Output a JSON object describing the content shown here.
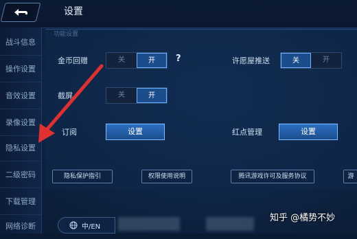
{
  "header": {
    "title": "设置",
    "back_icon": "back-arrow-icon"
  },
  "sidebar": {
    "items": [
      {
        "label": "战斗信息"
      },
      {
        "label": "操作设置"
      },
      {
        "label": "音效设置"
      },
      {
        "label": "录像设置"
      },
      {
        "label": "隐私设置"
      },
      {
        "label": "二级密码"
      },
      {
        "label": "下载管理"
      },
      {
        "label": "网络诊断"
      }
    ]
  },
  "panel": {
    "section_label": "功能设置",
    "gold_gift": {
      "label": "金币回赠",
      "off": "关",
      "on": "开",
      "help": "?"
    },
    "wish_push": {
      "label": "许愿屋推送",
      "on": "关",
      "off": "开"
    },
    "screenshot": {
      "label": "截屏",
      "off": "关",
      "on": "开"
    },
    "subscribe": {
      "label": "订阅",
      "button": "设置"
    },
    "red_dot": {
      "label": "红点管理",
      "button": "设置"
    },
    "links": [
      {
        "label": "隐私保护指引"
      },
      {
        "label": "权限使用说明"
      },
      {
        "label": "腾讯游戏许可及服务协议"
      },
      {
        "label": "游"
      }
    ]
  },
  "footer": {
    "lang_button": "中/EN",
    "globe_icon": "globe-icon"
  },
  "watermark": "知乎 @橘势不妙",
  "colors": {
    "accent": "#1b4d8c",
    "arrow": "#e03030"
  }
}
